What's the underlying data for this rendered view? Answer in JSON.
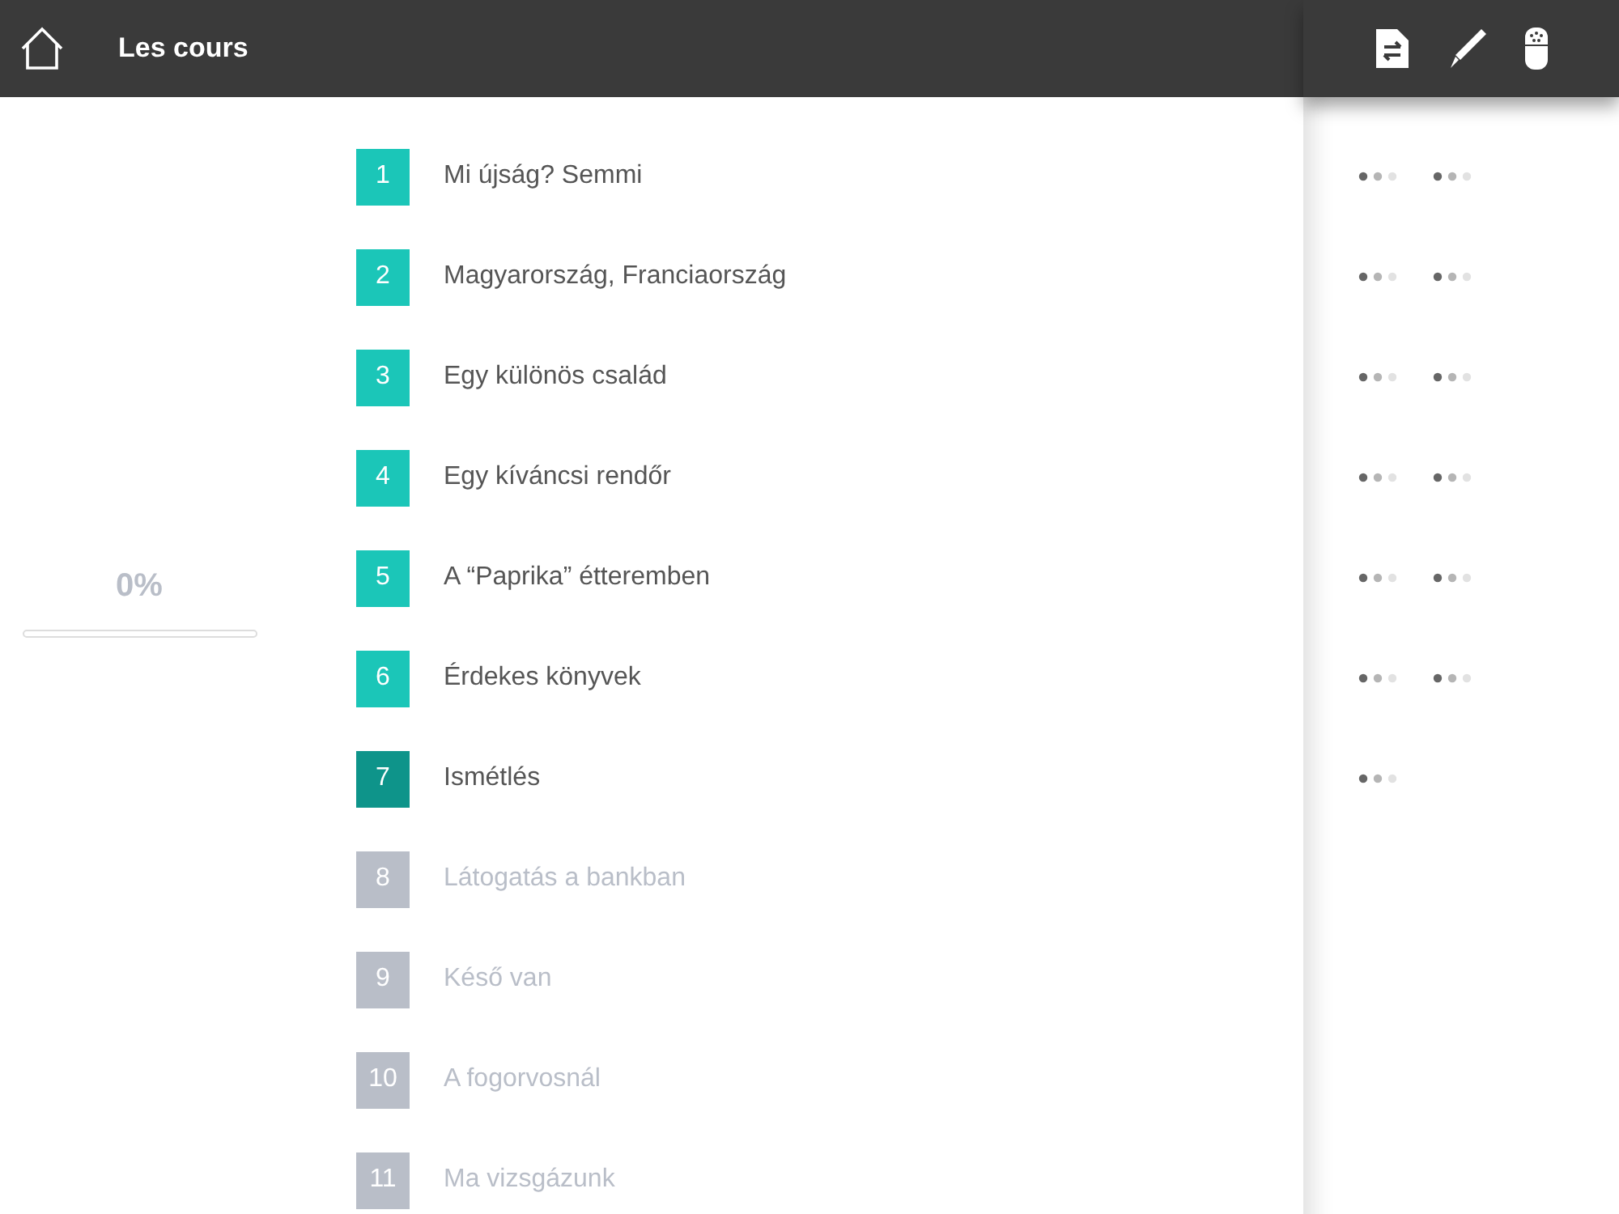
{
  "header": {
    "title": "Les cours"
  },
  "progress": {
    "label": "0%",
    "level": 0
  },
  "lessons": [
    {
      "number": "1",
      "title": "Mi újság? Semmi",
      "kind": "available",
      "indicators": [
        {
          "kind": "dots"
        },
        {
          "kind": "dots"
        }
      ]
    },
    {
      "number": "2",
      "title": "Magyarország, Franciaország",
      "kind": "available",
      "indicators": [
        {
          "kind": "dots"
        },
        {
          "kind": "dots"
        }
      ]
    },
    {
      "number": "3",
      "title": "Egy különös család",
      "kind": "available",
      "indicators": [
        {
          "kind": "dots"
        },
        {
          "kind": "dots"
        }
      ]
    },
    {
      "number": "4",
      "title": "Egy kíváncsi rendőr",
      "kind": "available",
      "indicators": [
        {
          "kind": "dots"
        },
        {
          "kind": "dots"
        }
      ]
    },
    {
      "number": "5",
      "title": "A “Paprika” étteremben",
      "kind": "available",
      "indicators": [
        {
          "kind": "dots"
        },
        {
          "kind": "dots"
        }
      ]
    },
    {
      "number": "6",
      "title": "Érdekes könyvek",
      "kind": "available",
      "indicators": [
        {
          "kind": "dots"
        },
        {
          "kind": "dots"
        }
      ]
    },
    {
      "number": "7",
      "title": "Ismétlés",
      "kind": "review",
      "indicators": [
        {
          "kind": "dots"
        }
      ]
    },
    {
      "number": "8",
      "title": "Látogatás a bankban",
      "kind": "locked"
    },
    {
      "number": "9",
      "title": "Késő van",
      "kind": "locked"
    },
    {
      "number": "10",
      "title": "A fogorvosnál",
      "kind": "locked"
    },
    {
      "number": "11",
      "title": "Ma vizsgázunk",
      "kind": "locked"
    }
  ]
}
